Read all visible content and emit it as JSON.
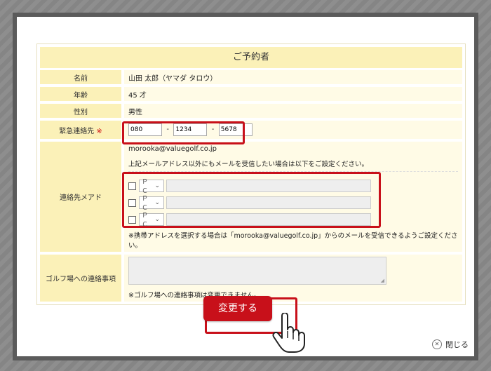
{
  "form": {
    "title": "ご予約者",
    "rows": {
      "name": {
        "label": "名前",
        "value": "山田 太郎（ヤマダ タロウ）"
      },
      "age": {
        "label": "年齢",
        "value": "45 才"
      },
      "gender": {
        "label": "性別",
        "value": "男性"
      },
      "emergency": {
        "label": "緊急連絡先",
        "required_mark": "※",
        "phone1": "080",
        "phone2": "1234",
        "phone3": "5678",
        "sep": "-"
      },
      "email": {
        "label": "連絡先メアド",
        "address": "morooka@valuegolf.co.jp",
        "info": "上記メールアドレス以外にもメールを受信したい場合は以下をご設定ください。",
        "device_option": "ＰＣ",
        "note": "※携帯アドレスを選択する場合は「morooka@valuegolf.co.jp」からのメールを受信できるようご設定ください。"
      },
      "golf": {
        "label": "ゴルフ場への連絡事項",
        "note": "※ゴルフ場への連絡事項は変更できません。"
      }
    }
  },
  "actions": {
    "change_label": "変更する",
    "close_label": "閉じる"
  },
  "colors": {
    "accent": "#c8101a",
    "label_bg": "#fbf1b8",
    "value_bg": "#fffbe6"
  },
  "icons": {
    "close": "close-icon",
    "pointer": "hand-pointer-icon",
    "chevron": "chevron-down-icon"
  }
}
